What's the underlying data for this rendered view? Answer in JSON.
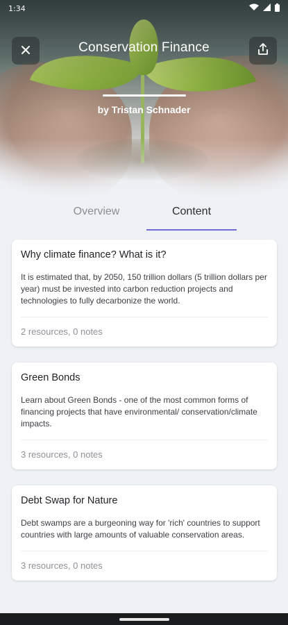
{
  "status_bar": {
    "time": "1:34"
  },
  "header": {
    "title": "Conservation Finance",
    "author": "by Tristan Schnader",
    "close_icon": "close-icon",
    "share_icon": "share-icon"
  },
  "tabs": [
    {
      "label": "Overview",
      "active": false
    },
    {
      "label": "Content",
      "active": true
    }
  ],
  "cards": [
    {
      "title": "Why climate finance? What is it?",
      "description": "It is estimated that, by 2050, 150 trillion dollars (5 trillion dollars per year) must be invested into carbon reduction projects and technologies to fully decarbonize the world.",
      "meta": "2 resources, 0 notes"
    },
    {
      "title": "Green Bonds",
      "description": "Learn about Green Bonds - one of the most common forms of financing projects that have environmental/ conservation/climate impacts.",
      "meta": "3 resources, 0 notes"
    },
    {
      "title": "Debt Swap for Nature",
      "description": "Debt swamps are a burgeoning way for 'rich' countries to support countries with large amounts of valuable conservation areas.",
      "meta": "3 resources, 0 notes"
    }
  ],
  "colors": {
    "tab_indicator": "#6f6ad8",
    "page_background": "#eef1f5"
  }
}
